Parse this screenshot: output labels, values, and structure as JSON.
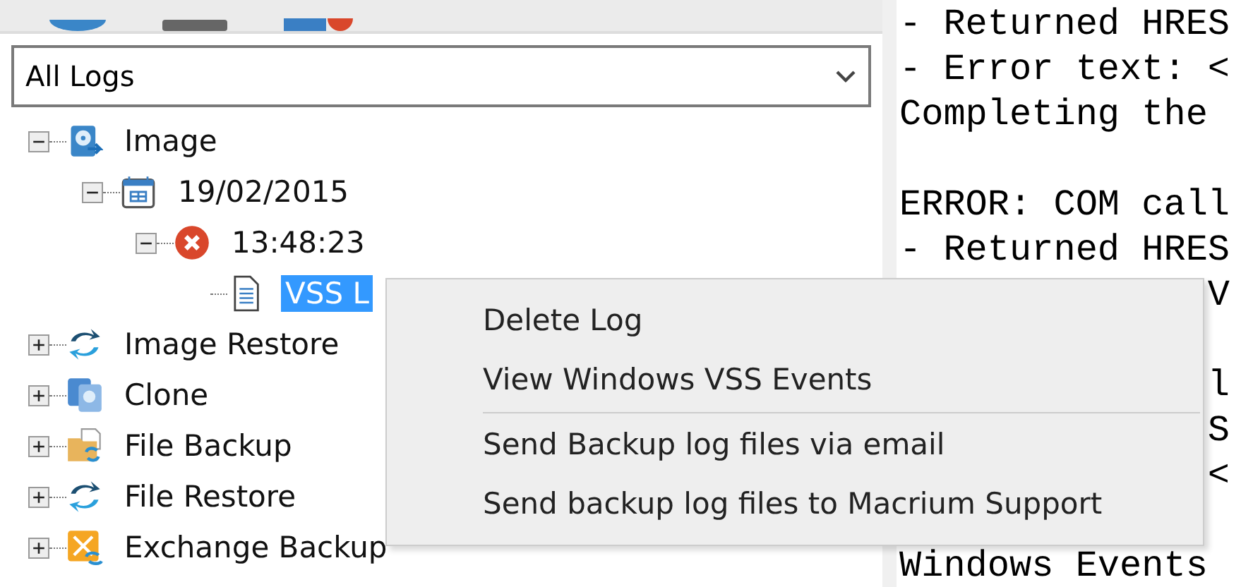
{
  "log_filter": {
    "value": "All Logs"
  },
  "tree": [
    {
      "label": "Image",
      "kind": "disk",
      "expanded": true,
      "selected": false,
      "children": [
        {
          "label": "19/02/2015",
          "kind": "calendar",
          "expanded": true,
          "selected": false,
          "children": [
            {
              "label": "13:48:23",
              "kind": "error",
              "expanded": true,
              "selected": false,
              "children": [
                {
                  "label": "VSS L",
                  "kind": "document",
                  "selected": true
                }
              ]
            }
          ]
        }
      ]
    },
    {
      "label": "Image Restore",
      "kind": "restore",
      "expanded": false,
      "selected": false
    },
    {
      "label": "Clone",
      "kind": "clone",
      "expanded": false,
      "selected": false
    },
    {
      "label": "File Backup",
      "kind": "folder",
      "expanded": false,
      "selected": false
    },
    {
      "label": "File Restore",
      "kind": "restore",
      "expanded": false,
      "selected": false
    },
    {
      "label": "Exchange Backup",
      "kind": "exchange",
      "expanded": false,
      "selected": false
    }
  ],
  "log_lines": [
    {
      "text": "- Returned HRES",
      "kind": "plain"
    },
    {
      "text": "- Error text: <",
      "kind": "plain"
    },
    {
      "text": "Completing the",
      "kind": "plain"
    },
    {
      "kind": "blank"
    },
    {
      "text": "ERROR: COM call",
      "kind": "plain"
    },
    {
      "text": "- Returned HRES",
      "kind": "plain"
    },
    {
      "text": "V",
      "kind": "covered"
    },
    {
      "kind": "blank"
    },
    {
      "text": "l",
      "kind": "covered"
    },
    {
      "text": "S",
      "kind": "covered"
    },
    {
      "text": "<",
      "kind": "covered"
    },
    {
      "kind": "blank"
    },
    {
      "text": "Windows Events",
      "kind": "plain"
    }
  ],
  "context_menu": [
    {
      "label": "Delete Log",
      "kind": "item"
    },
    {
      "label": "View Windows VSS Events",
      "kind": "item"
    },
    {
      "kind": "separator"
    },
    {
      "label": "Send Backup log files via email",
      "kind": "item"
    },
    {
      "label": "Send backup log files to Macrium Support",
      "kind": "item"
    }
  ]
}
